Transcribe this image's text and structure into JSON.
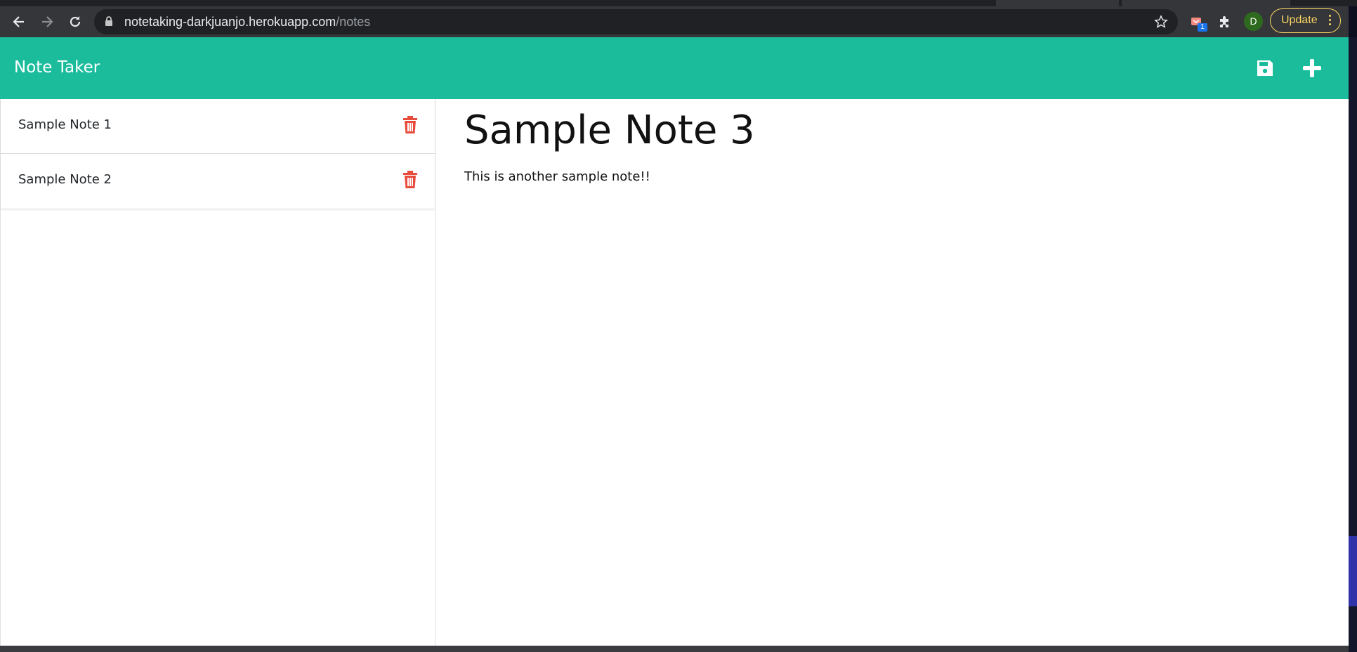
{
  "browser": {
    "url_host": "notetaking-darkjuanjo.herokuapp.com",
    "url_path": "/notes",
    "extension_badge": "1",
    "profile_initial": "D",
    "update_label": "Update",
    "icons": [
      "back-arrow-icon",
      "forward-arrow-icon",
      "reload-icon",
      "lock-icon",
      "star-icon",
      "extension-icon",
      "puzzle-icon",
      "more-vert-icon"
    ]
  },
  "app": {
    "title": "Note Taker",
    "accent_color": "#1abc9c",
    "delete_color": "#e74c3c",
    "header_icons": [
      "save-icon",
      "plus-icon"
    ]
  },
  "notes": [
    {
      "title": "Sample Note 1"
    },
    {
      "title": "Sample Note 2"
    }
  ],
  "active_note": {
    "title": "Sample Note 3",
    "text": "This is another sample note!!"
  }
}
